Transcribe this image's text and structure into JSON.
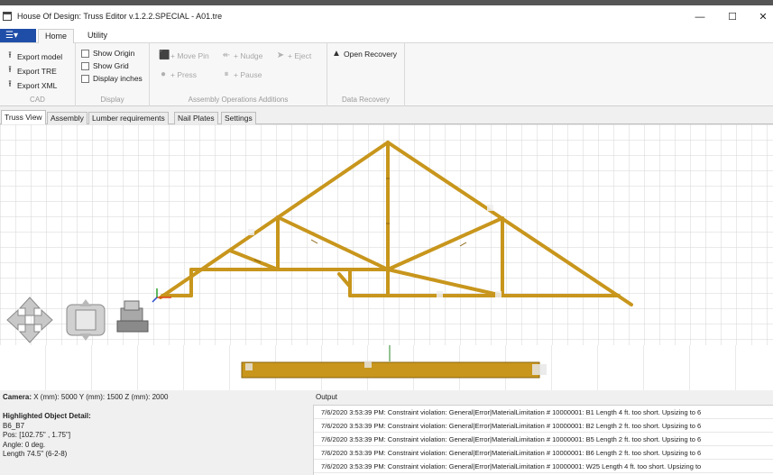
{
  "window": {
    "title": "House Of Design: Truss Editor v.1.2.2.SPECIAL - A01.tre",
    "minimize_glyph": "—",
    "maximize_glyph": "☐",
    "close_glyph": "✕"
  },
  "menubar": {
    "app_menu_glyph": "☰▾",
    "tabs": [
      "Home",
      "Utility"
    ]
  },
  "ribbon": {
    "cad": {
      "label": "CAD",
      "items": [
        "Export model",
        "Export TRE",
        "Export XML"
      ]
    },
    "display": {
      "label": "Display",
      "items": [
        "Show Origin",
        "Show Grid",
        "Display inches"
      ]
    },
    "assembly": {
      "label": "Assembly Operations Additions",
      "move_pin": "+ Move Pin",
      "nudge": "+ Nudge",
      "eject": "+ Eject",
      "press": "+ Press",
      "pause": "+ Pause"
    },
    "recovery": {
      "label": "Data Recovery",
      "open_recovery": "Open Recovery"
    }
  },
  "view_tabs": [
    "Truss View",
    "Assembly",
    "Lumber requirements",
    "Nail Plates",
    "Settings"
  ],
  "colors": {
    "lumber": "#c8961c",
    "lumber_edge": "#8a6410",
    "grid": "#d6d6d6",
    "menu_blue": "#1f4ea8"
  },
  "camera": {
    "label": "Camera:",
    "x_label": "X (mm):",
    "x": "5000",
    "y_label": "Y (mm):",
    "y": "1500",
    "z_label": "Z (mm):",
    "z": "2000"
  },
  "detail": {
    "heading": "Highlighted Object Detail:",
    "name": "B6_B7",
    "pos": "Pos: [102.75\" , 1.75\"]",
    "angle": "Angle: 0 deg.",
    "length": "Length 74.5\" (6-2-8)"
  },
  "output": {
    "label": "Output",
    "lines": [
      "7/6/2020 3:53:39 PM: Constraint violation: General|Error|MaterialLimitation # 10000001: B1 Length 4 ft. too short. Upsizing to 6",
      "7/6/2020 3:53:39 PM: Constraint violation: General|Error|MaterialLimitation # 10000001: B2 Length 2 ft. too short. Upsizing to 6",
      "7/6/2020 3:53:39 PM: Constraint violation: General|Error|MaterialLimitation # 10000001: B5 Length 2 ft. too short. Upsizing to 6",
      "7/6/2020 3:53:39 PM: Constraint violation: General|Error|MaterialLimitation # 10000001: B6 Length 2 ft. too short. Upsizing to 6",
      "7/6/2020 3:53:39 PM: Constraint violation: General|Error|MaterialLimitation # 10000001: W25 Length 4 ft. too short. Upsizing to"
    ]
  }
}
